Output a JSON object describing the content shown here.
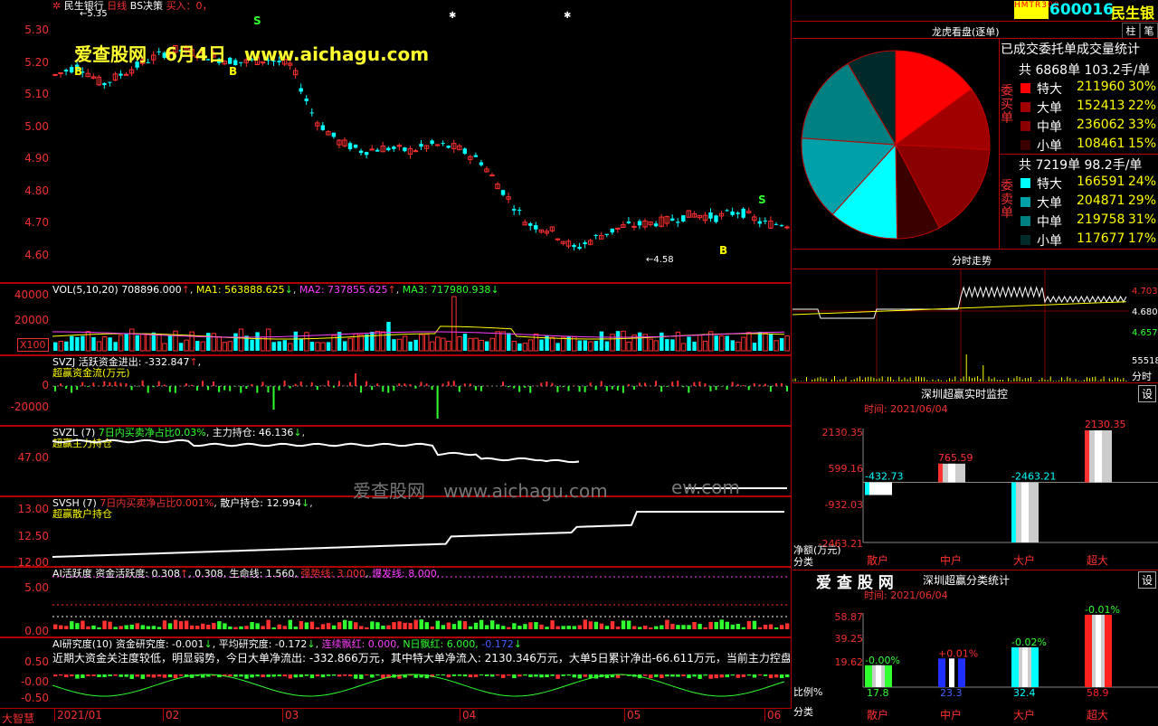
{
  "header": {
    "stock_name": "民生银行",
    "period": "日线",
    "strategy": "BS决策",
    "buy_text": "买入：0，",
    "high_marker": "5.35",
    "low_marker": "4.58",
    "right_code": "600016",
    "right_name": "民生银",
    "hmtr_badge": "HMTR300",
    "btn_zhu": "柱",
    "btn_bi": "笔"
  },
  "watermark": {
    "banner": "爱查股网　6月4日　www.aichagu.com",
    "center": "爱查股网　www.aichagu.com",
    "center_tail": "ew.com"
  },
  "price_axis": [
    "5.30",
    "5.20",
    "5.10",
    "5.00",
    "4.90",
    "4.80",
    "4.70",
    "4.60"
  ],
  "bs_marks": [
    "B",
    "B",
    "S",
    "S",
    "B"
  ],
  "vol": {
    "label": "VOL(5,10,20)",
    "val": "708896.000",
    "ma1": "MA1: 563888.625",
    "ma2": "MA2: 737855.625",
    "ma3": "MA3: 717980.938",
    "axis": [
      "40000",
      "20000"
    ],
    "unit": "X100"
  },
  "svzj": {
    "l1": "SVZJ  活跃资金进出: -332.847",
    "l2": "超赢资金流(万元)",
    "axis": [
      "0",
      "-20000"
    ]
  },
  "svzl": {
    "l1": "SVZL (7)",
    "l2": "7日内买卖净占比0.03%",
    "l3": "主力持仓: 46.136",
    "l4": "超赢主力持仓",
    "axis": [
      "47.00"
    ]
  },
  "svsh": {
    "l1": "SVSH (7)",
    "l2": "7日内买卖净占比0.001%",
    "l3": "散户持仓: 12.994",
    "l4": "超赢散户持仓",
    "axis": [
      "13.00",
      "12.50",
      "12.00"
    ]
  },
  "ai": {
    "l1": "AI活跃度  资金活跃度: 0.308",
    "l2": ", 0.308, 生命线: 1.560, ",
    "l3": "强势线: 3.000",
    "l4": "爆发线: 8.000,",
    "axis": [
      "5.00",
      "0.00"
    ]
  },
  "res": {
    "l1": "AI研究度(10) 资金研究度: -0.001",
    "l2": ", 平均研究度: -0.172",
    "l3": "连续飘红: 0.000,",
    "l4": "N日飘红: 6.000,",
    "l5": "-0.172",
    "note": "近期大资金关注度较低，明显弱势，今日大单净流出: -332.866万元，其中特大单净流入: 2130.346万元，大单5日累计净出-66.611万元，当前主力控盘弱",
    "axis": [
      "0.50",
      "-0.00",
      "-0.50"
    ]
  },
  "date_axis": {
    "left": "大智慧",
    "labels": [
      "2021/01",
      "02",
      "03",
      "04",
      "05",
      "06"
    ]
  },
  "lhb": {
    "title": "龙虎看盘(逐单)",
    "subtitle": "已成交委托单成交量统计",
    "buy": {
      "total": "共 6868单 103.2手/单",
      "side": "委买单",
      "rows": [
        [
          "特大",
          "211960",
          "30%"
        ],
        [
          "大单",
          "152413",
          "22%"
        ],
        [
          "中单",
          "236062",
          "33%"
        ],
        [
          "小单",
          "108461",
          "15%"
        ]
      ]
    },
    "sell": {
      "total": "共 7219单 98.2手/单",
      "side": "委卖单",
      "rows": [
        [
          "特大",
          "166591",
          "24%"
        ],
        [
          "大单",
          "204871",
          "29%"
        ],
        [
          "中单",
          "219758",
          "31%"
        ],
        [
          "小单",
          "117677",
          "17%"
        ]
      ]
    },
    "pie_pct": [
      30,
      22,
      33,
      15,
      24,
      29,
      31,
      17
    ]
  },
  "fenshi": {
    "title": "分时走势",
    "axis": [
      "4.703",
      "4.680",
      "4.657",
      "55518"
    ],
    "unit": "分时"
  },
  "monitor": {
    "title": "深圳超赢实时监控",
    "btn": "设",
    "time": "时间: 2021/06/04",
    "axis": [
      "2130.35",
      "599.16",
      "-932.03",
      "-2463.21"
    ],
    "ylab": "净额(万元)",
    "xlab": "分类",
    "bars": [
      {
        "cat": "散户",
        "val": "-432.73",
        "v": -432.73
      },
      {
        "cat": "中户",
        "val": "765.59",
        "v": 765.59
      },
      {
        "cat": "大户",
        "val": "-2463.21",
        "v": -2463.21
      },
      {
        "cat": "超大",
        "val": "2130.35",
        "v": 2130.35
      }
    ]
  },
  "classify": {
    "brand": "爱 查 股 网",
    "title": "深圳超赢分类统计",
    "btn": "设",
    "time": "时间: 2021/06/04",
    "axis": [
      "58.87",
      "39.25",
      "19.62"
    ],
    "ylab": "比例%",
    "xlab": "分类",
    "bars": [
      {
        "cat": "散户",
        "val": "17.8",
        "chg": "-0.00%",
        "v": 17.8
      },
      {
        "cat": "中户",
        "val": "23.3",
        "chg": "+0.01%",
        "v": 23.3
      },
      {
        "cat": "大户",
        "val": "32.4",
        "chg": "-0.02%",
        "v": 32.4
      },
      {
        "cat": "超大",
        "val": "58.9",
        "chg": "-0.01%",
        "v": 58.9
      }
    ]
  }
}
